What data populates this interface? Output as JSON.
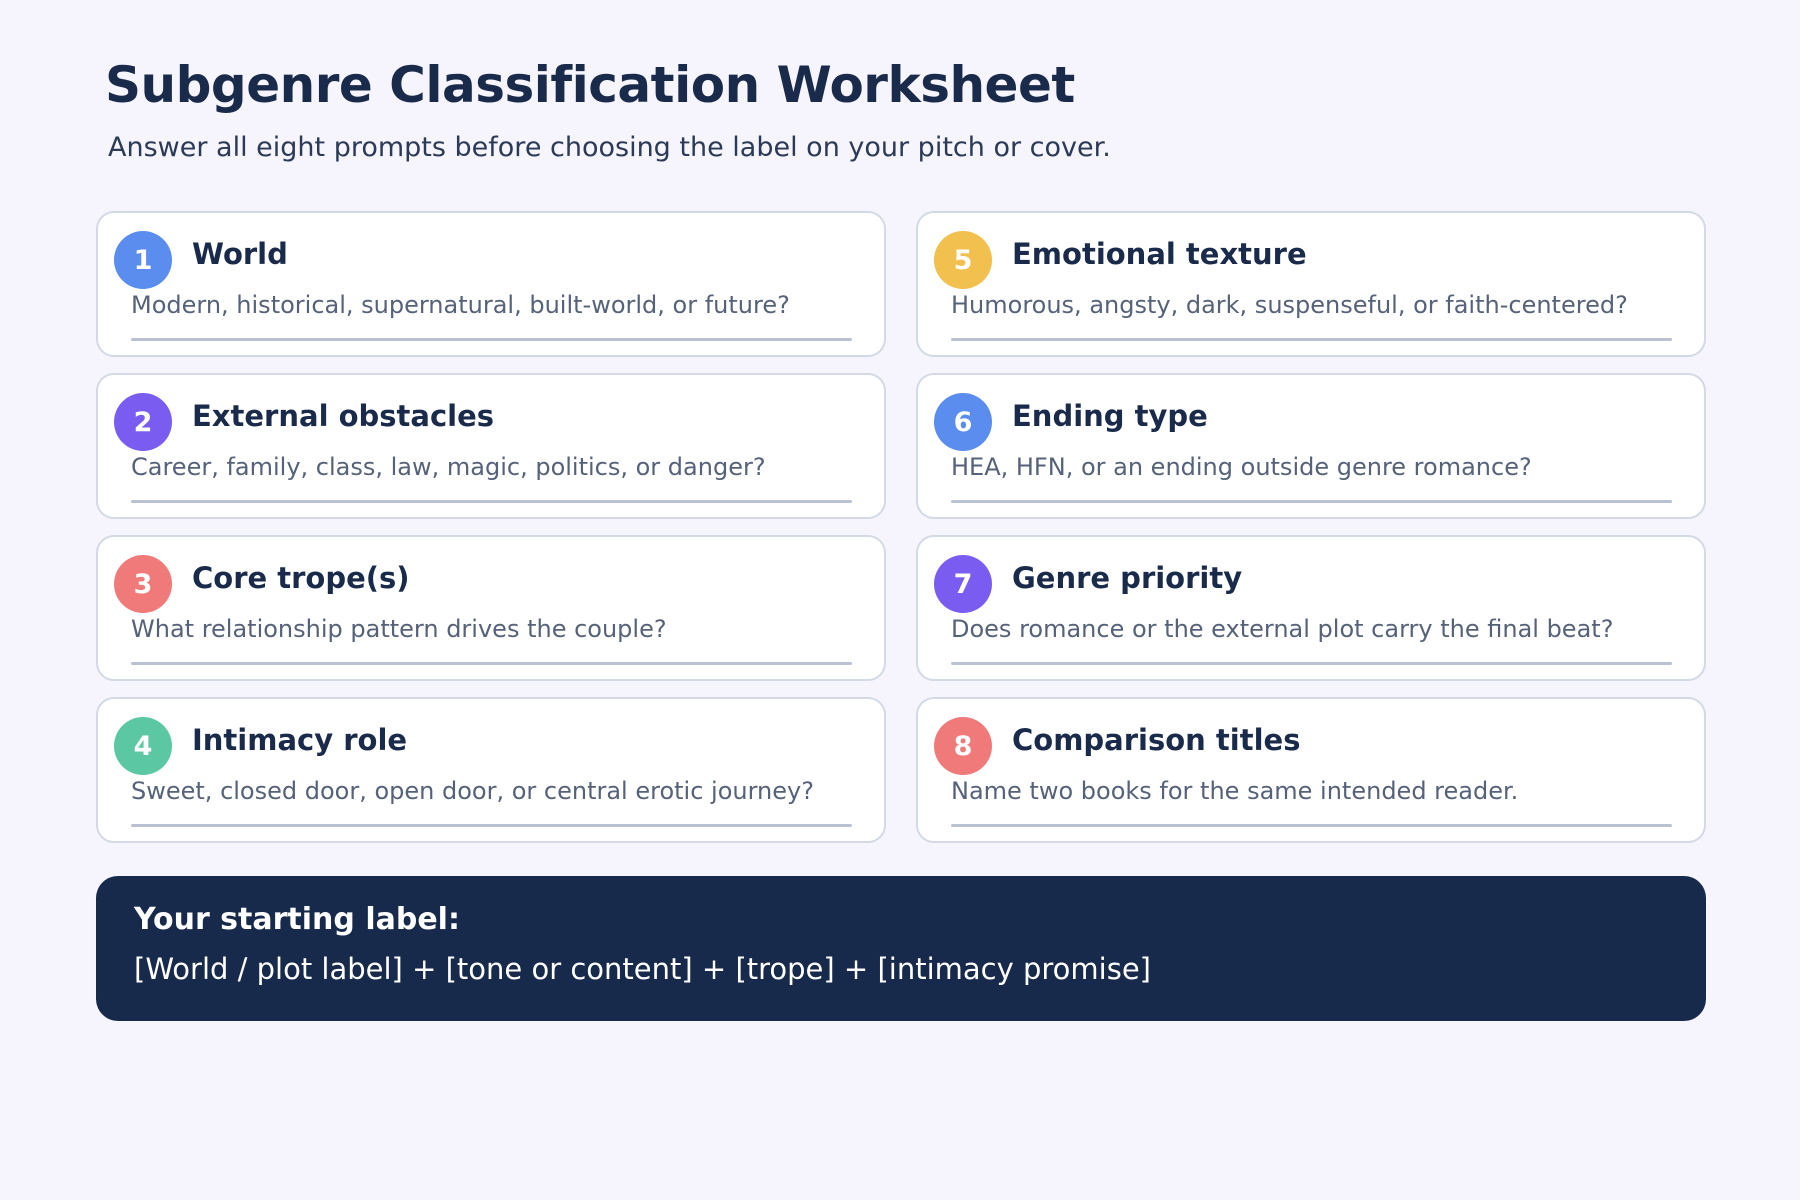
{
  "header": {
    "title": "Subgenre Classification Worksheet",
    "subtitle": "Answer all eight prompts before choosing the label on your pitch or cover."
  },
  "prompts": [
    {
      "number": "1",
      "title": "World",
      "prompt": "Modern, historical, supernatural, built-world, or future?",
      "color": "#5b8def"
    },
    {
      "number": "2",
      "title": "External obstacles",
      "prompt": "Career, family, class, law, magic, politics, or danger?",
      "color": "#7b5cf0"
    },
    {
      "number": "3",
      "title": "Core trope(s)",
      "prompt": "What relationship pattern drives the couple?",
      "color": "#f07a7a"
    },
    {
      "number": "4",
      "title": "Intimacy role",
      "prompt": "Sweet, closed door, open door, or central erotic journey?",
      "color": "#5cc8a3"
    },
    {
      "number": "5",
      "title": "Emotional texture",
      "prompt": "Humorous, angsty, dark, suspenseful, or faith-centered?",
      "color": "#f2c04e"
    },
    {
      "number": "6",
      "title": "Ending type",
      "prompt": "HEA, HFN, or an ending outside genre romance?",
      "color": "#5b8def"
    },
    {
      "number": "7",
      "title": "Genre priority",
      "prompt": "Does romance or the external plot carry the final beat?",
      "color": "#7b5cf0"
    },
    {
      "number": "8",
      "title": "Comparison titles",
      "prompt": "Name two books for the same intended reader.",
      "color": "#f07a7a"
    }
  ],
  "starting_label": {
    "heading": "Your starting label:",
    "formula": "[World / plot label] + [tone or content] + [trope] + [intimacy promise]"
  }
}
